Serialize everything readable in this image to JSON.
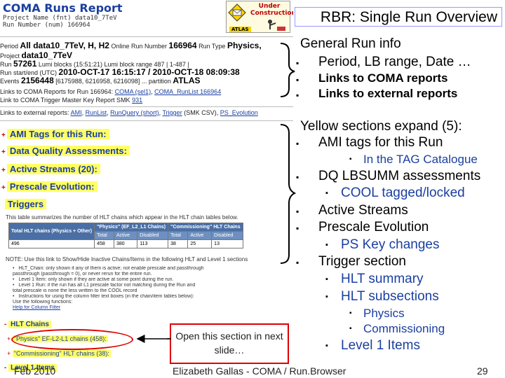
{
  "screenshot": {
    "header": {
      "title": "COMA Runs Report",
      "line1": "Project Name (fnt)   data10_7TeV",
      "line2": "Run Number (num)   166964",
      "under_construction": "Under Construction",
      "atlas_label": "ATLAS"
    },
    "info": {
      "period_label": "Period",
      "period_value": "All data10_7TeV, H, H2",
      "online_run_label": "Online Run Number",
      "online_run_value": "166964",
      "run_type_label": "Run Type",
      "run_type_value": "Physics,",
      "project_label": "Project",
      "project_value": "data10_7TeV",
      "run_label": "Run",
      "run_value": "57261",
      "run_rest": "Lumi blocks (15:51:21) Lumi block range  487 | 1-487 |",
      "date_label": "Run start/end (UTC)",
      "date_value": "2010-OCT-17 16:15:17 / 2010-OCT-18 08:09:38",
      "events_label": "Events",
      "events_value": "2156448",
      "events_rest": "[6175988, 6216958, 6216098] ... partition",
      "partition_value": "ATLAS",
      "links_label": "Links to COMA Reports for Run 166964:",
      "link_coma": "COMA (sel1)",
      "link_runlist": "COMA_RunList 166964",
      "trigger_master_label": "Link to COMA Trigger Master Key Report  SMK",
      "trigger_master_value": "931",
      "links_ext_label": "Links to external reports:",
      "link_ami": "AMI",
      "link_runlist2": "RunList",
      "link_runquery": "RunQuery (short)",
      "link_trigger": "Trigger",
      "link_trigger_extra": "(SMK CSV)",
      "link_ps": "PS_Evolution"
    },
    "sections": {
      "ami": "AMI Tags for this Run:",
      "dq": "Data Quality Assessments:",
      "streams": "Active Streams (20):",
      "prescale": "Prescale Evolution:",
      "triggers": "Triggers"
    },
    "trigger_note": "This table summarizes the number of HLT chains which appear in the HLT chain tables below.",
    "trigger_table": {
      "col1": "Total HLT chains (Physics + Other)",
      "col2": "\"Physics\" (EF_L2_L1 Chains)",
      "col3": "\"Commissioning\" HLT Chains",
      "sub1": "Total",
      "sub2": "Active",
      "sub3": "Disabled",
      "sub4": "Total",
      "sub5": "Active",
      "sub6": "Disabled",
      "row": [
        "496",
        "458",
        "380",
        "113",
        "38",
        "25",
        "13"
      ]
    },
    "note2": "NOTE: Use this link to Show/Hide Inactive Chains/Items in the following HLT and Level 1 sections",
    "bullets": [
      "HLT_Chain: only shown if any of them is active; not enable prescale and passthrough",
      "passthrough (passthrough = 0), or never rerun for the entire run.",
      "Level 1 Item: only shown if they are active at some point during the run.",
      "Level 1 Run: if the run has all L1 prescale factor not matching during the Run and",
      "total prescale is none the less written to the COOL record",
      "Instructions for using the column filter text boxes (in the chain/item tables below):",
      "Use the following functions:",
      "Help for Column Filter"
    ],
    "hlt": {
      "title": "HLT Chains",
      "physics": "\"Physics\" EF-L2-L1 chains (458):",
      "commissioning": "\"Commissioning\" HLT chains (38):",
      "level1": "Level 1 Items"
    },
    "callout": "Open this section in next slide…"
  },
  "slide": {
    "title": "RBR: Single Run Overview",
    "general_header": "General Run info",
    "general_items": [
      "Period, LB range, Date …",
      "Links to COMA reports",
      "Links to external reports"
    ],
    "yellow_header": "Yellow sections expand (5):",
    "ami": "AMI tags for this Run",
    "ami_sub": "In the TAG Catalogue",
    "dq": "DQ LBSUMM assessments",
    "dq_sub": "COOL tagged/locked",
    "streams": "Active Streams",
    "prescale": "Prescale Evolution",
    "prescale_sub": "PS Key changes",
    "trigger": "Trigger section",
    "trigger_sub1": "HLT summary",
    "trigger_sub2": "HLT subsections",
    "trigger_sub2_items": [
      "Physics",
      "Commissioning"
    ],
    "level1": "Level 1 Items"
  },
  "footer": {
    "date": "Feb 2010",
    "author": "Elizabeth Gallas - COMA / Run.Browser",
    "page": "29"
  },
  "colors": {
    "link_blue": "#1a3fa0",
    "highlight_yellow": "#ffff66",
    "callout_red": "#e00000"
  }
}
